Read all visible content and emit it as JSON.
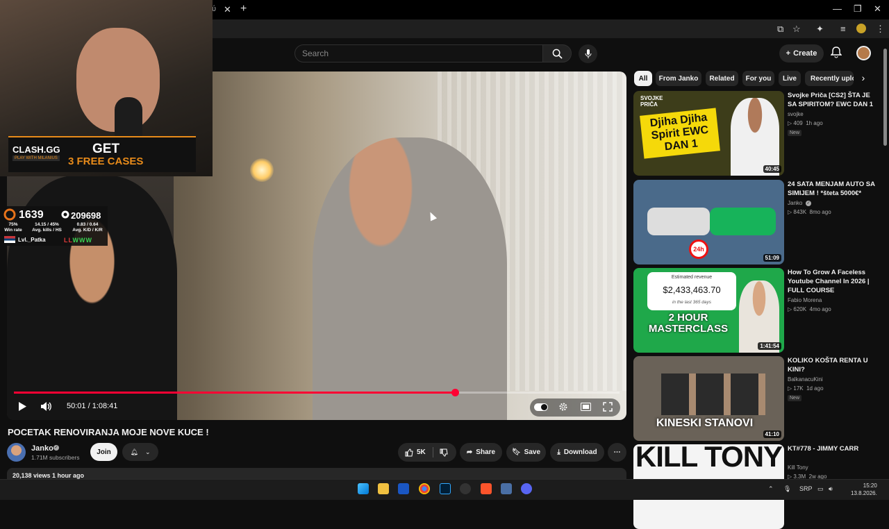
{
  "header": {
    "search_placeholder": "Search",
    "create_label": "Create"
  },
  "player": {
    "time_current": "50:01",
    "time_sep": " / ",
    "time_total": "1:08:41",
    "progress": 0.728
  },
  "overlay": {
    "promo_brand": "CLASH.GG",
    "promo_sub": "PLAY WITH MILANIUS",
    "promo_get": "GET",
    "promo_cases": "3 FREE CASES",
    "elo": "1639",
    "points": "209698",
    "stat1": "75%",
    "stat1_label": "Win rate",
    "stat2": "14.15 / 45%",
    "stat2_label": "Avg. kills / HS",
    "stat3": "0.83 / 0.64",
    "stat3_label": "Avg. K/D / K/R",
    "player_name": "Lvl._Patka",
    "form": [
      "L",
      "L",
      "W",
      "W",
      "W"
    ]
  },
  "video": {
    "title": "POCETAK RENOVIRANJA MOJE NOVE KUCE !",
    "channel": "Janko",
    "subscribers": "1.71M subscribers",
    "join_label": "Join",
    "likes": "5K",
    "share_label": "Share",
    "save_label": "Save",
    "download_label": "Download",
    "description_stub": "20,138 views  1 hour ago"
  },
  "chips": [
    "All",
    "From Janko",
    "Related",
    "For you",
    "Live",
    "Recently uplo"
  ],
  "recommendations": [
    {
      "title": "Svojke Priča [CS2] ŠTA JE SA SPIRITOM? EWC DAN 1",
      "channel": "svojke",
      "views": "409",
      "age": "1h ago",
      "badge": "New",
      "duration": "40:45",
      "thumb_text": "Djiha Djiha Spirit EWC DAN 1",
      "thumb_tag": "SVOJKE PRIČA",
      "thumb_bg": "#3d3d1a"
    },
    {
      "title": "24 SATA MENJAM AUTO SA SIMIJEM ! *šteta 5000€*",
      "channel": "Janko",
      "views": "843K",
      "age": "8mo ago",
      "badge": "",
      "duration": "51:09",
      "thumb_text": "24h",
      "thumb_tag": "",
      "thumb_bg": "#4a6a8a"
    },
    {
      "title": "How To Grow A Faceless Youtube Channel In 2026 | FULL COURSE",
      "channel": "Fabio Morena",
      "views": "620K",
      "age": "4mo ago",
      "badge": "",
      "duration": "1:41:54",
      "thumb_text": "2 HOUR MASTERCLASS",
      "thumb_tag": "Estimated revenue",
      "thumb_amount": "$2,433,463.70",
      "thumb_sub": "in the last 365 days",
      "thumb_bg": "#1fa84a"
    },
    {
      "title": "KOLIKO KOŠTA RENTA U KINI?",
      "channel": "BalkanacuKini",
      "views": "17K",
      "age": "1d ago",
      "badge": "New",
      "duration": "41:10",
      "thumb_text": "KINESKI STANOVI",
      "thumb_tag": "",
      "thumb_bg": "#6a6258"
    },
    {
      "title": "KT#778 - JIMMY CARR",
      "channel": "Kill Tony",
      "views": "3.3M",
      "age": "2w ago",
      "badge": "",
      "duration": "",
      "thumb_text": "KILL TONY",
      "thumb_tag": "",
      "thumb_bg": "#f4f4f4"
    }
  ],
  "taskbar": {
    "lang": "SRP",
    "time": "15:20",
    "date": "13.8.2026."
  }
}
